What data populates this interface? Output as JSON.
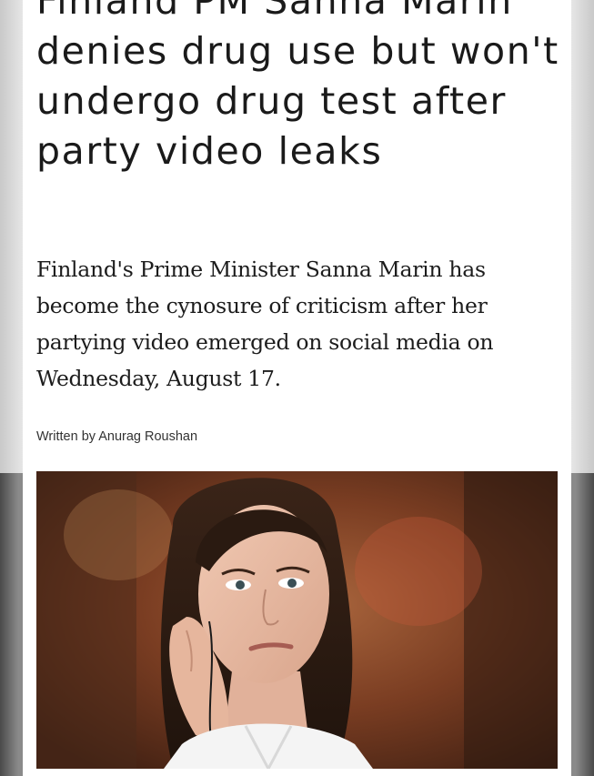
{
  "article": {
    "headline": "Finland PM Sanna Marin denies drug use but won't undergo drug test after party video leaks",
    "dek": "Finland's Prime Minister Sanna Marin has become the cynosure of criticism after her partying video emerged on social media on Wednesday, August 17.",
    "byline": "Written by Anurag Roushan"
  },
  "photo": {
    "subject": "portrait-of-sanna-marin"
  }
}
